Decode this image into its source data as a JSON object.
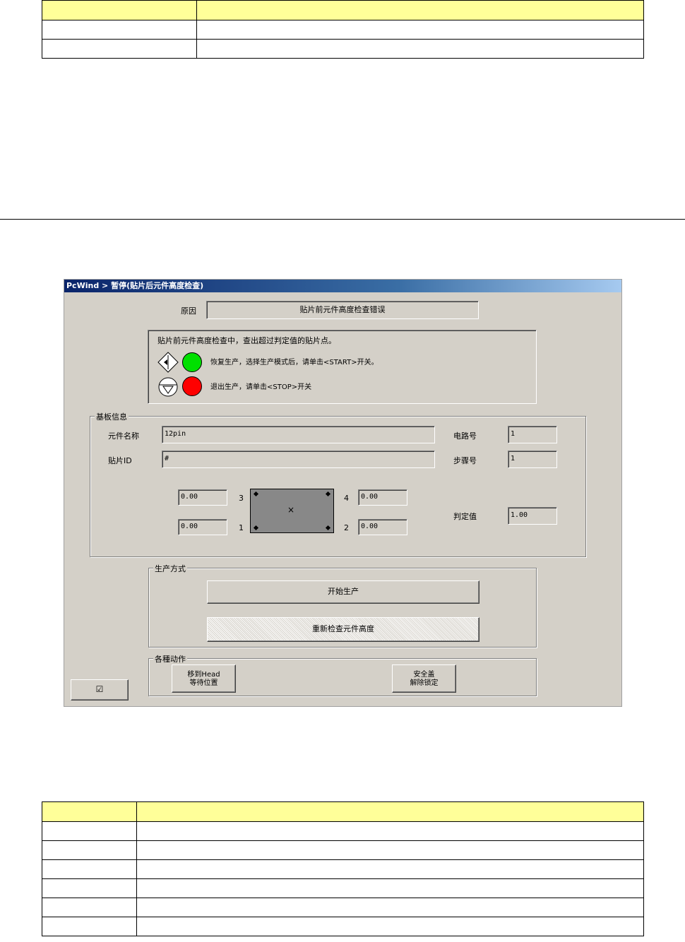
{
  "dialog": {
    "title": "PcWind > 暂停(贴片后元件高度检查)",
    "cause_label": "原因",
    "cause_value": "贴片前元件高度检查错误",
    "message": {
      "heading": "贴片前元件高度检查中，查出超过判定值的贴片点。",
      "resume_text": "恢复生产，选择生产模式后，请单击<START>开关。",
      "stop_text": "退出生产，请单击<STOP>开关",
      "colors": {
        "green": "#00e000",
        "red": "#ff0000"
      }
    },
    "board_info": {
      "legend": "基板信息",
      "component_name_label": "元件名称",
      "component_name_value": "12pin",
      "placement_id_label": "贴片ID",
      "placement_id_value": "#",
      "circuit_no_label": "电路号",
      "circuit_no_value": "1",
      "step_no_label": "步骤号",
      "step_no_value": "1",
      "judge_value_label": "判定值",
      "judge_value_value": "1.00",
      "corners": {
        "c3_label": "3",
        "c3_value": "0.00",
        "c4_label": "4",
        "c4_value": "0.00",
        "c1_label": "1",
        "c1_value": "0.00",
        "c2_label": "2",
        "c2_value": "0.00"
      },
      "center_mark": "×"
    },
    "production_mode": {
      "legend": "生产方式",
      "start_button": "开始生产",
      "recheck_button": "重新检查元件高度"
    },
    "actions": {
      "legend": "各種动作",
      "move_head_line1": "移到Head",
      "move_head_line2": "等待位置",
      "safety_line1": "安全盖",
      "safety_line2": "解除锁定"
    },
    "small_button_icon": "☑"
  },
  "colors": {
    "table_header": "#ffff99",
    "dialog_bg": "#d4d0c8"
  }
}
